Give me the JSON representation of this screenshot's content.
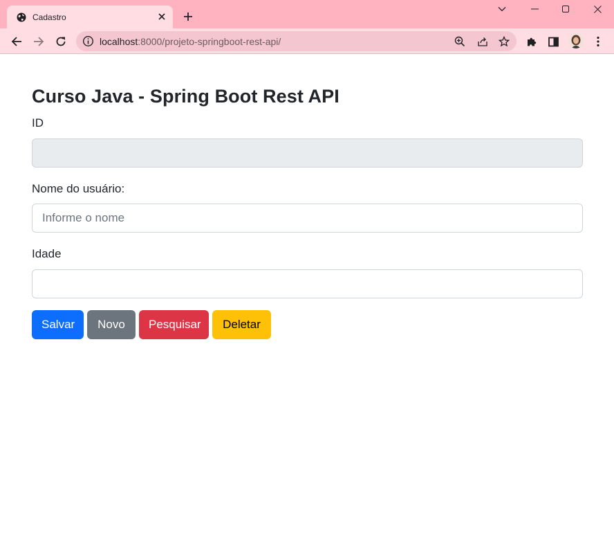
{
  "browser": {
    "tab_title": "Cadastro",
    "url_host": "localhost",
    "url_rest": ":8000/projeto-springboot-rest-api/"
  },
  "page": {
    "title": "Curso Java - Spring Boot Rest API",
    "id_label": "ID",
    "id_value": "",
    "name_label": "Nome do usuário:",
    "name_placeholder": "Informe o nome",
    "name_value": "",
    "age_label": "Idade",
    "age_value": "",
    "buttons": {
      "save": "Salvar",
      "new": "Novo",
      "search": "Pesquisar",
      "delete": "Deletar"
    }
  },
  "colors": {
    "chrome_frame": "#ffb3c1",
    "chrome_toolbar": "#ffdde3",
    "primary": "#0d6efd",
    "secondary": "#6c757d",
    "danger": "#dc3545",
    "warning": "#ffc107"
  },
  "icons": {
    "tab_favicon": "globe-icon",
    "tab_close": "close-icon",
    "new_tab": "plus-icon",
    "window_menu": "chevron-down-icon",
    "minimize": "minimize-icon",
    "maximize": "maximize-icon",
    "close_window": "close-icon",
    "back": "arrow-left-icon",
    "forward": "arrow-right-icon",
    "reload": "reload-icon",
    "site_info": "info-icon",
    "zoom": "zoom-icon",
    "share": "share-icon",
    "bookmark": "star-icon",
    "extensions": "puzzle-icon",
    "side_panel": "side-panel-icon",
    "profile": "avatar",
    "menu": "kebab-menu-icon"
  }
}
